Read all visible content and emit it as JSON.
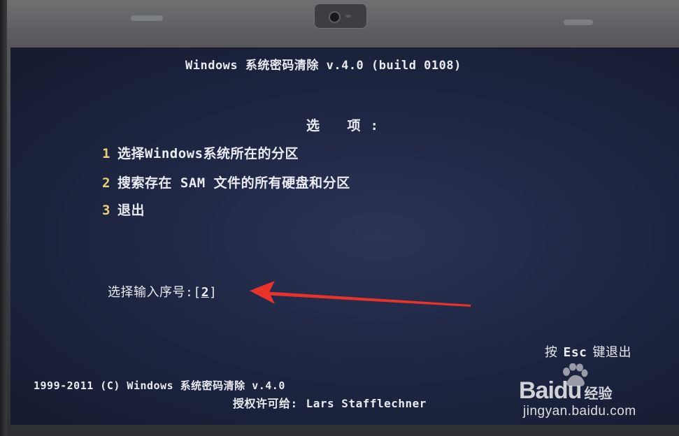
{
  "screen": {
    "title": "Windows 系统密码清除 v.4.0 (build 0108)",
    "options_heading": "选 项:",
    "menu": [
      {
        "num": "1",
        "label": "选择Windows系统所在的分区"
      },
      {
        "num": "2",
        "label": "搜索存在 SAM 文件的所有硬盘和分区"
      },
      {
        "num": "3",
        "label": "退出"
      }
    ],
    "prompt": {
      "label": "选择输入序号:",
      "open": "[",
      "value": "2",
      "close": "]"
    },
    "esc_hint": {
      "prefix": "按",
      "key": "Esc",
      "suffix": "键退出"
    },
    "copyright": "1999-2011 (C)  Windows 系统密码清除 v.4.0",
    "license": {
      "prefix": "授权许可给:",
      "name": "Lars Stafflechner"
    }
  },
  "annotation": {
    "arrow_color": "#e8322a"
  },
  "colors": {
    "screen_bg": "#1f2744",
    "text": "#e9ebf2",
    "number_accent": "#e6d27a"
  },
  "watermark": {
    "logo": "Baidu",
    "logo_suffix": "经验",
    "domain": "jingyan.baidu.com",
    "icon": "baidu-paw-icon"
  }
}
